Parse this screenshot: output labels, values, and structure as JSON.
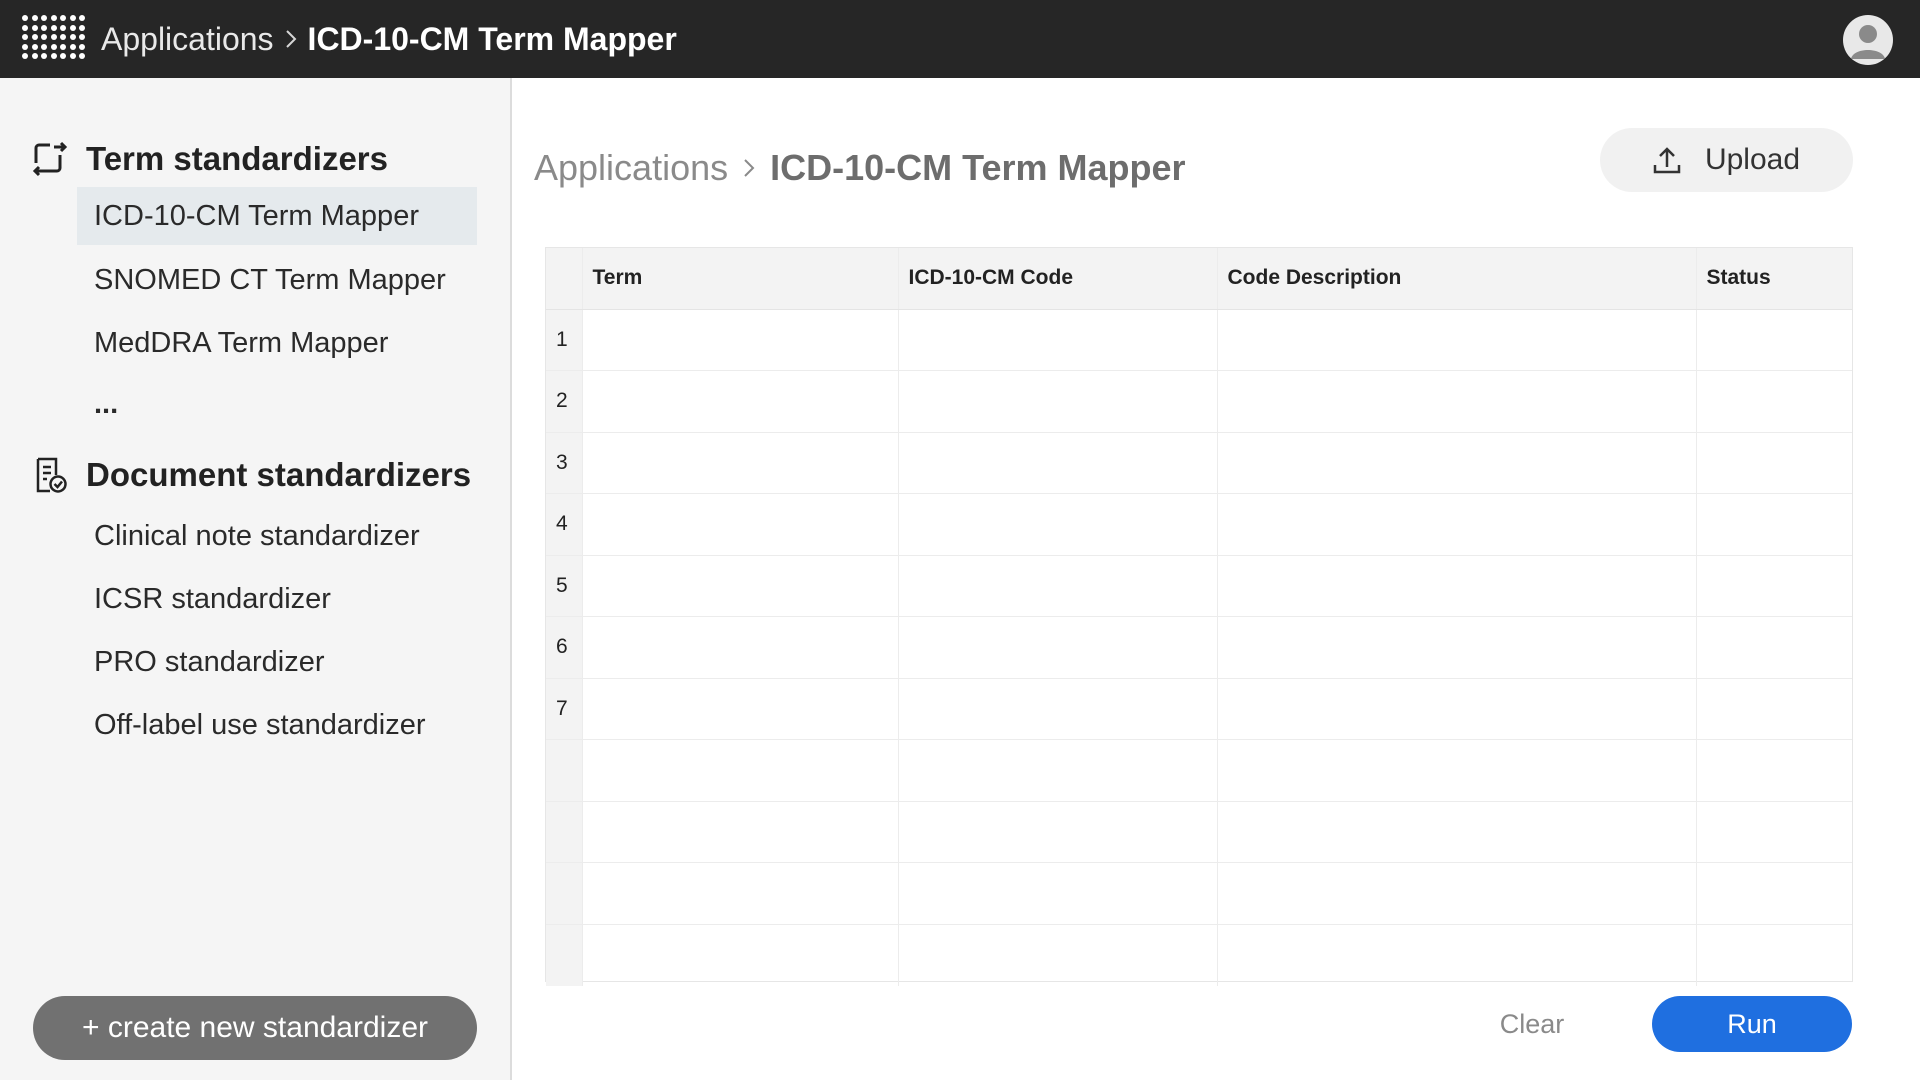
{
  "topbar": {
    "apps_icon": "grid-icon",
    "breadcrumb": {
      "parent": "Applications",
      "current": "ICD-10-CM Term Mapper"
    },
    "avatar_icon": "user-avatar-icon"
  },
  "sidebar": {
    "sections": [
      {
        "title": "Term standardizers",
        "icon": "term-standardizer-icon",
        "items": [
          {
            "label": "ICD-10-CM Term Mapper",
            "active": true
          },
          {
            "label": "SNOMED CT Term Mapper"
          },
          {
            "label": "MedDRA Term Mapper"
          },
          {
            "label": "..."
          }
        ]
      },
      {
        "title": "Document standardizers",
        "icon": "document-check-icon",
        "items": [
          {
            "label": "Clinical note standardizer"
          },
          {
            "label": "ICSR standardizer"
          },
          {
            "label": "PRO standardizer"
          },
          {
            "label": "Off-label use standardizer"
          }
        ]
      }
    ],
    "create_label": "+ create new standardizer"
  },
  "main": {
    "breadcrumb": {
      "parent": "Applications",
      "current": "ICD-10-CM Term Mapper"
    },
    "upload_label": "Upload",
    "upload_icon": "upload-icon",
    "table": {
      "columns": [
        "Term",
        "ICD-10-CM Code",
        "Code Description",
        "Status"
      ],
      "row_numbers": [
        "1",
        "2",
        "3",
        "4",
        "5",
        "6",
        "7",
        "",
        "",
        "",
        ""
      ]
    },
    "clear_label": "Clear",
    "run_label": "Run"
  },
  "colors": {
    "topbar_bg": "#262626",
    "sidebar_bg": "#f5f5f5",
    "active_item_bg": "#e5eaed",
    "run_button": "#1f6fe0",
    "create_button": "#717171"
  }
}
